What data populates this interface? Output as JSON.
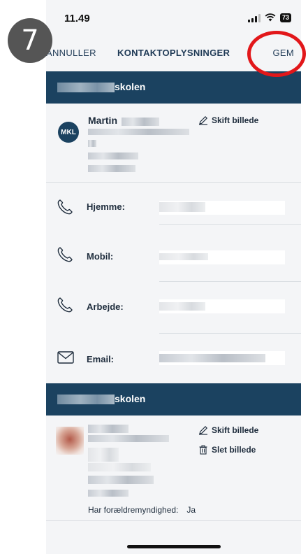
{
  "annotation": {
    "step": "7"
  },
  "status": {
    "time": "11.49",
    "battery": "73"
  },
  "nav": {
    "cancel": "ANNULLER",
    "title": "KONTAKTOPLYSNINGER",
    "save": "GEM"
  },
  "sections": [
    {
      "suffix": "skolen"
    },
    {
      "suffix": "skolen"
    }
  ],
  "profile1": {
    "initials": "MKL",
    "name": "Martin",
    "change_photo": "Skift billede"
  },
  "contact_rows": [
    {
      "label": "Hjemme:",
      "icon": "phone-icon"
    },
    {
      "label": "Mobil:",
      "icon": "phone-icon"
    },
    {
      "label": "Arbejde:",
      "icon": "phone-icon"
    },
    {
      "label": "Email:",
      "icon": "mail-icon"
    }
  ],
  "profile2": {
    "change_photo": "Skift billede",
    "delete_photo": "Slet billede",
    "custody_label": "Har forældremyndighed:",
    "custody_value": "Ja"
  },
  "colors": {
    "header": "#1b4260",
    "annotation_ring": "#e2171a",
    "badge": "#555555"
  }
}
